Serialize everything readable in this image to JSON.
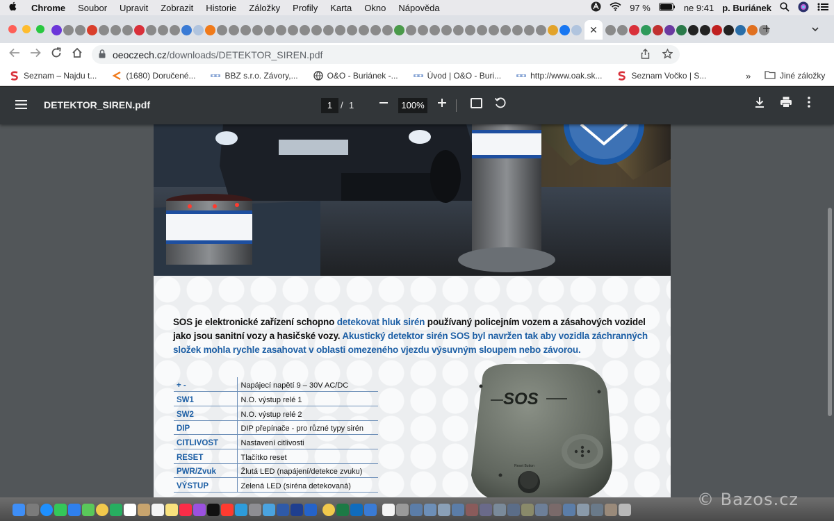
{
  "menubar": {
    "apple": "",
    "items": [
      "Chrome",
      "Soubor",
      "Upravit",
      "Zobrazit",
      "Historie",
      "Záložky",
      "Profily",
      "Karta",
      "Okno",
      "Nápověda"
    ],
    "battery": "97 %",
    "datetime": "ne 9:41",
    "user": "p. Buriánek"
  },
  "browser": {
    "active_tab_close": "✕",
    "new_tab": "+",
    "address": {
      "host": "oeoczech.cz",
      "path": "/downloads/DETEKTOR_SIREN.pdf"
    },
    "bookmarks": [
      "Seznam – Najdu t...",
      "(1680) Doručené...",
      "BBZ s.r.o. Závory,...",
      "O&O - Buriánek -...",
      "Úvod | O&O - Buri...",
      "http://www.oak.sk...",
      "Seznam Vočko | S..."
    ],
    "bookmarks_more": "»",
    "other_bookmarks": "Jiné záložky"
  },
  "pdf": {
    "title": "DETEKTOR_SIREN.pdf",
    "page_current": "1",
    "page_sep": "/",
    "page_total": "1",
    "zoom": "100%"
  },
  "document": {
    "intro_part1": "SOS je elektronické zařízení schopno ",
    "intro_highlight1": "detekovat hluk sirén",
    "intro_part2": " používaný policejním vozem a zásahových vozidel jako jsou sanitní vozy a hasičské vozy. ",
    "intro_highlight2": "Akustický detektor sirén SOS byl navržen tak aby vozidla záchranných složek mohla rychle zasahovat v oblasti omezeného vjezdu výsuvným sloupem nebo závorou.",
    "spec": [
      {
        "key": "+ -",
        "value": "Napájecí napětí 9 – 30V AC/DC"
      },
      {
        "key": "SW1",
        "value": "N.O. výstup relé 1"
      },
      {
        "key": "SW2",
        "value": "N.O. výstup relé 2"
      },
      {
        "key": "DIP",
        "value": "DIP přepínače - pro různé typy sirén"
      },
      {
        "key": "CITLIVOST",
        "value": "Nastavení citlivosti"
      },
      {
        "key": "RESET",
        "value": "Tlačítko reset"
      },
      {
        "key": "PWR/Zvuk",
        "value": "Žlutá LED (napájení/detekce zvuku)"
      },
      {
        "key": "VÝSTUP",
        "value": "Zelená LED (siréna detekovaná)"
      }
    ],
    "device_logo": "SOS",
    "device_button_label": "Reset Button"
  },
  "watermark": "© Bazos.cz",
  "colors": {
    "highlight": "#1d5fa5",
    "pdf_toolbar": "#323639",
    "viewer_bg": "#525659"
  }
}
